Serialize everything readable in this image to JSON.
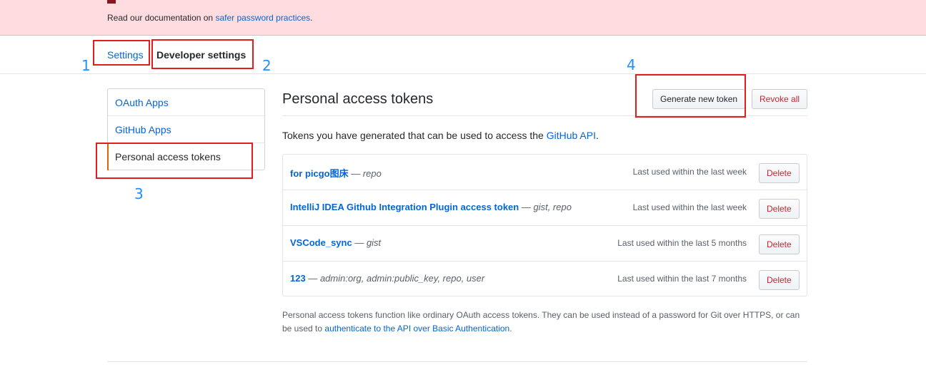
{
  "flash": {
    "doc_prefix": "Read our documentation on ",
    "doc_link": "safer password practices",
    "doc_suffix": "."
  },
  "breadcrumb": {
    "settings": "Settings",
    "developer_settings": "Developer settings"
  },
  "annotations": {
    "n1": "1",
    "n2": "2",
    "n3": "3",
    "n4": "4"
  },
  "sidebar": {
    "items": [
      {
        "label": "OAuth Apps"
      },
      {
        "label": "GitHub Apps"
      },
      {
        "label": "Personal access tokens"
      }
    ]
  },
  "main": {
    "title": "Personal access tokens",
    "generate_label": "Generate new token",
    "revoke_label": "Revoke all",
    "intro_prefix": "Tokens you have generated that can be used to access the ",
    "intro_link": "GitHub API",
    "intro_suffix": ".",
    "tokens": [
      {
        "name": "for picgo图床",
        "sep": " — ",
        "scopes": "repo",
        "last_used": "Last used within the last week",
        "delete_label": "Delete"
      },
      {
        "name": "IntelliJ IDEA Github Integration Plugin access token",
        "sep": " — ",
        "scopes": "gist, repo",
        "last_used": "Last used within the last week",
        "delete_label": "Delete"
      },
      {
        "name": "VSCode_sync",
        "sep": " — ",
        "scopes": "gist",
        "last_used": "Last used within the last 5 months",
        "delete_label": "Delete"
      },
      {
        "name": "123",
        "sep": " — ",
        "scopes": "admin:org, admin:public_key, repo, user",
        "last_used": "Last used within the last 7 months",
        "delete_label": "Delete"
      }
    ],
    "footnote_text": "Personal access tokens function like ordinary OAuth access tokens. They can be used instead of a password for Git over HTTPS, or can be used to ",
    "footnote_link": "authenticate to the API over Basic Authentication",
    "footnote_suffix": "."
  },
  "colors": {
    "link": "#0366d6",
    "danger": "#cb2431",
    "flash_bg": "#ffdce0",
    "annotation_box": "#e11d1d",
    "annotation_number": "#1e90ff"
  }
}
